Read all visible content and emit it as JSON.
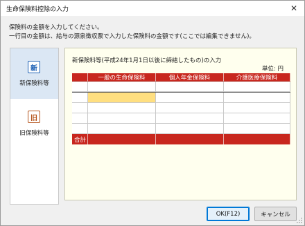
{
  "window": {
    "title": "生命保険料控除の入力",
    "close_glyph": "✕"
  },
  "instructions": {
    "line1": "保険料の金額を入力してください。",
    "line2": "一行目の金額は、給与の源泉徴収票で入力した保険料の金額です(ここでは編集できません)。"
  },
  "nav": {
    "items": [
      {
        "icon_char": "新",
        "label": "新保険料等",
        "icon_color": "#1a5fb4",
        "selected": true
      },
      {
        "icon_char": "旧",
        "label": "旧保険料等",
        "icon_color": "#b5541c",
        "selected": false
      }
    ]
  },
  "content": {
    "heading": "新保険料等(平成24年1月1日以後に締結したもの)の入力",
    "unit": "単位:  円",
    "table": {
      "columns": [
        "一般の生命保険料",
        "個人年金保険料",
        "介護医療保険料"
      ],
      "rows": [
        [
          "",
          "",
          ""
        ],
        [
          "",
          "",
          ""
        ],
        [
          "",
          "",
          ""
        ],
        [
          "",
          "",
          ""
        ],
        [
          "",
          "",
          ""
        ]
      ],
      "total_label": "合計",
      "active_cell": "row 2, 一般の生命保険料"
    }
  },
  "buttons": {
    "ok": "OK(F12)",
    "cancel": "キャンセル"
  },
  "colors": {
    "header_red": "#c8271e",
    "active_cell": "#ffdf80",
    "content_bg": "#ffffee",
    "nav_selected": "#dbe7f4"
  }
}
